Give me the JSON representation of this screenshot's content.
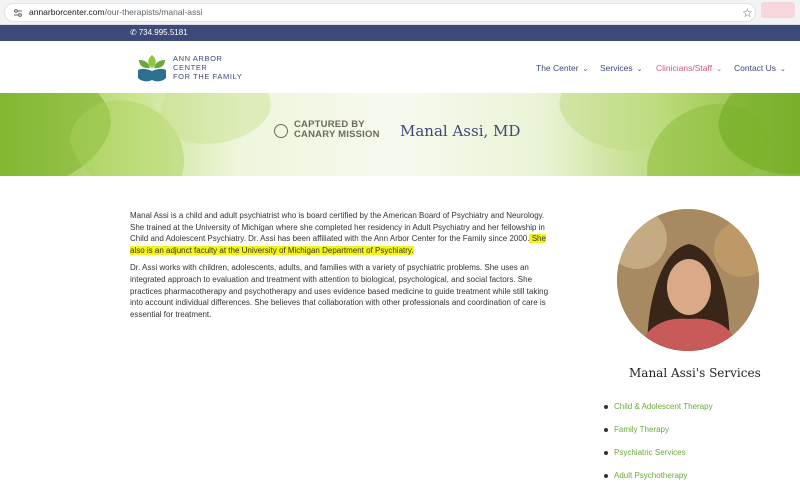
{
  "browser": {
    "url_domain": "annarborcenter.com",
    "url_path": "/our-therapists/manal-assi"
  },
  "topbar": {
    "phone": "734.995.5181"
  },
  "logo": {
    "line1": "ANN ARBOR",
    "line2": "CENTER",
    "line3": "FOR THE FAMILY"
  },
  "nav": [
    {
      "label": "The Center"
    },
    {
      "label": "Services"
    },
    {
      "label": "Clinicians/Staff"
    },
    {
      "label": "Contact Us"
    }
  ],
  "hero": {
    "watermark_line1": "CAPTURED BY",
    "watermark_line2": "CANARY MISSION",
    "title": "Manal Assi, MD"
  },
  "bio": {
    "p1_part1": "Manal Assi is a child and adult psychiatrist who is board certified by the American Board of Psychiatry and Neurology. She trained at the University of Michigan where she completed her residency in Adult Psychiatry and her fellowship in Child and Adolescent Psychiatry.  Dr. Assi has been affiliated with the Ann Arbor Center for the Family since 2000.",
    "p1_highlight": " She also is an adjunct faculty at the University of Michigan Department of Psychiatry.",
    "p2": "Dr. Assi works with children, adolescents, adults, and families with a variety of psychiatric problems.  She uses an integrated approach to evaluation and treatment with attention to biological, psychological, and social factors.  She practices pharmacotherapy and psychotherapy and uses evidence based medicine to guide treatment while still taking into account individual differences. She believes that collaboration with other professionals and coordination of care is essential for treatment."
  },
  "sidebar": {
    "services_title": "Manal Assi's Services",
    "services": [
      "Child & Adolescent Therapy",
      "Family Therapy",
      "Psychiatric Services",
      "Adult Psychotherapy"
    ]
  },
  "colors": {
    "navy": "#3b4a78",
    "active_nav": "#d05a78",
    "service_link": "#6aa83b",
    "highlight": "#f4f41a"
  }
}
